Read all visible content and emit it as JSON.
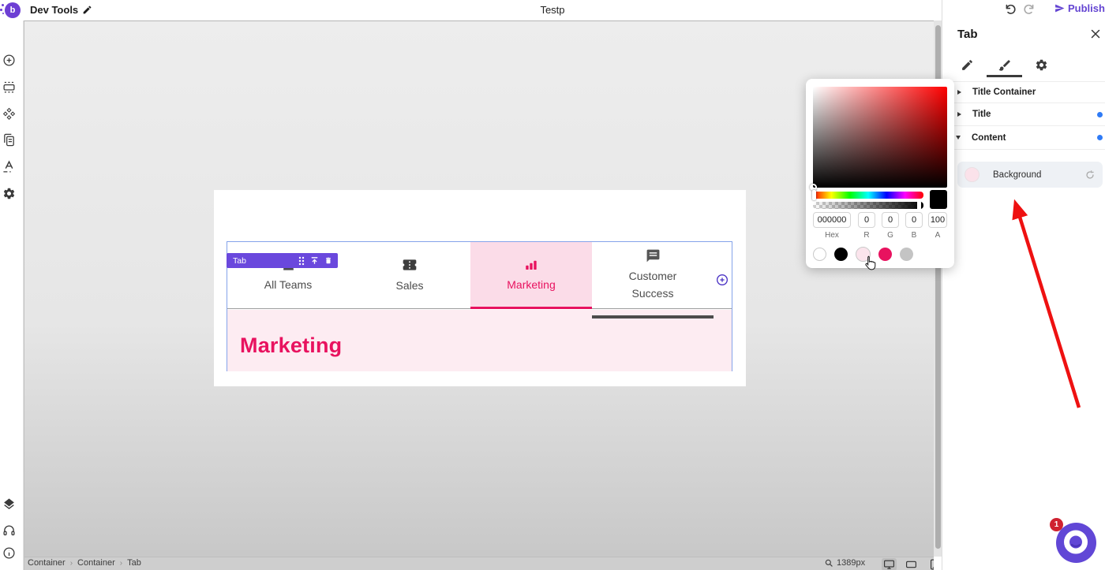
{
  "topbar": {
    "app_name": "Dev Tools",
    "doc_title": "Testp",
    "publish_label": "Publish"
  },
  "canvas": {
    "selection_badge": "Tab",
    "tabs": [
      {
        "label": "All Teams",
        "icon": "users-icon",
        "active": false
      },
      {
        "label": "Sales",
        "icon": "ticket-icon",
        "active": false
      },
      {
        "label": "Marketing",
        "icon": "bar-chart-icon",
        "active": true
      },
      {
        "label": "Customer Success",
        "icon": "chat-icon",
        "active": false
      }
    ],
    "content_heading": "Marketing"
  },
  "picker": {
    "hex_value": "000000",
    "r_value": "0",
    "g_value": "0",
    "b_value": "0",
    "a_value": "100",
    "hex_label": "Hex",
    "r_label": "R",
    "g_label": "G",
    "b_label": "B",
    "a_label": "A",
    "swatches": [
      "#ffffff",
      "#000000",
      "#fbe4ec",
      "#e8125f",
      "#c4c4c4"
    ]
  },
  "inspector": {
    "title": "Tab",
    "sections": [
      {
        "label": "Title Container",
        "expanded": false,
        "modified": false
      },
      {
        "label": "Title",
        "expanded": false,
        "modified": true
      },
      {
        "label": "Content",
        "expanded": true,
        "modified": true
      }
    ],
    "background_label": "Background",
    "background_swatch_color": "#fbe2ea"
  },
  "statusbar": {
    "breadcrumbs": [
      "Container",
      "Container",
      "Tab"
    ],
    "zoom_label": "1389px"
  },
  "chat": {
    "badge_count": "1"
  },
  "colors": {
    "brand_purple": "#6344d2",
    "accent_pink": "#e8125f",
    "tab_active_bg": "#fbdce8",
    "content_bg": "#fdecf2",
    "selection_blue": "#84a3ea",
    "modified_dot_blue": "#2f7bf6",
    "arrow_red": "#ee1111",
    "picked_color_hex": "#000000"
  }
}
